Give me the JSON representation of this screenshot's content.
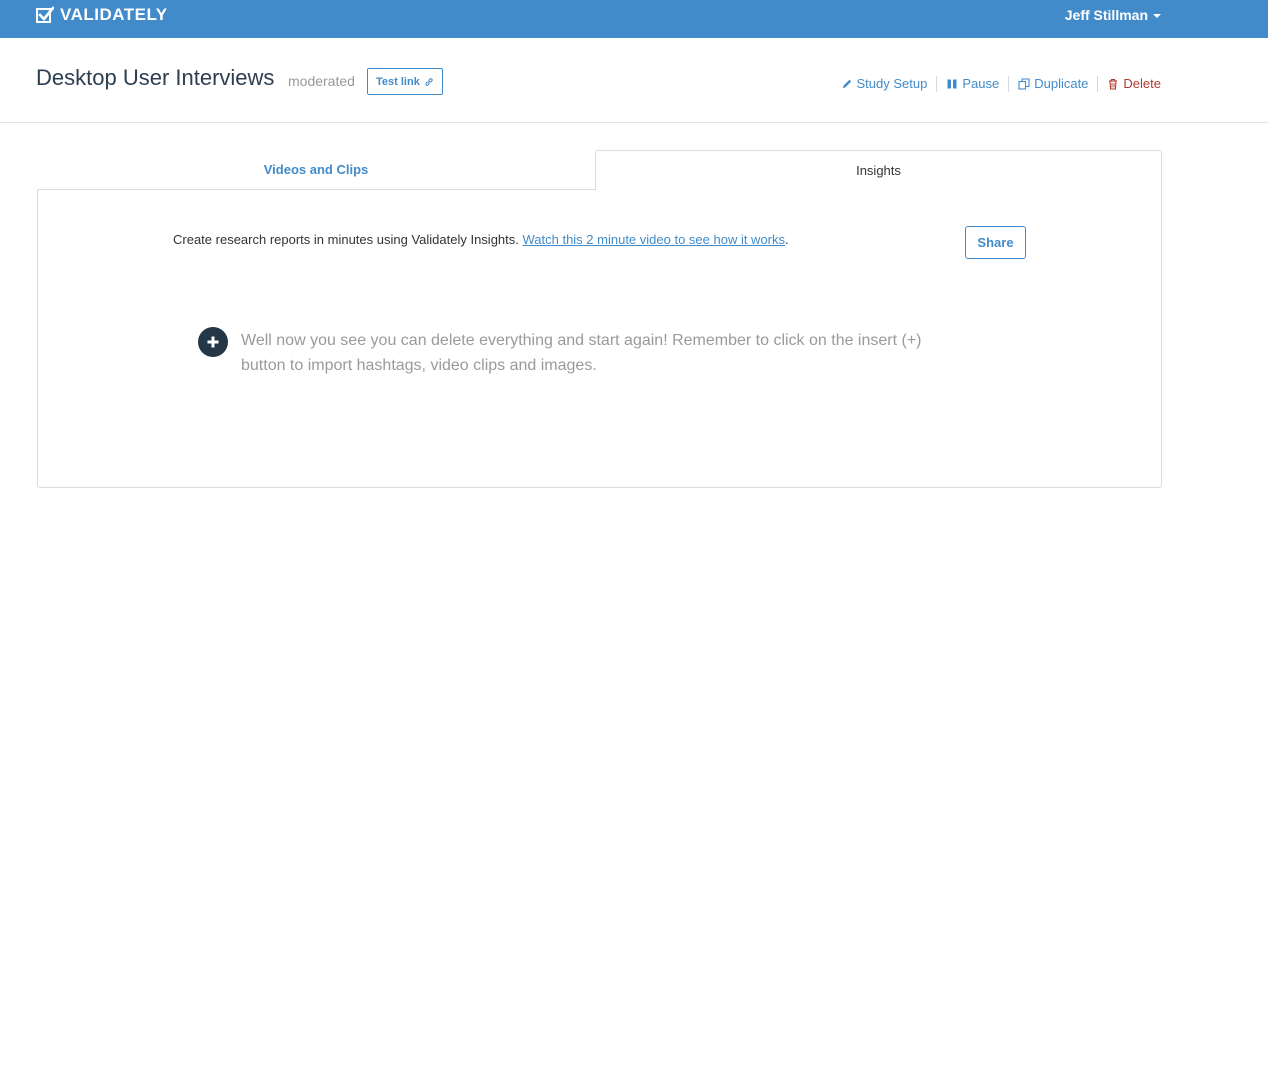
{
  "brand": {
    "name": "VALIDATELY",
    "nav_color": "#428bca"
  },
  "user": {
    "name": "Jeff Stillman"
  },
  "study": {
    "title": "Desktop User Interviews",
    "type": "moderated",
    "test_link_label": "Test link"
  },
  "actions": {
    "setup": "Study Setup",
    "pause": "Pause",
    "duplicate": "Duplicate",
    "delete": "Delete",
    "accent_color": "#428bca",
    "danger_color": "#b03a30"
  },
  "tabs": [
    {
      "label": "Videos and Clips",
      "active": false
    },
    {
      "label": "Insights",
      "active": true
    }
  ],
  "insights": {
    "intro_text": "Create research reports in minutes using Validately Insights. ",
    "intro_link": "Watch this 2 minute video to see how it works",
    "intro_end": ".",
    "share_label": "Share",
    "placeholder": "Well now you see you can delete everything and start again! Remember to click on the insert (+) button to import hashtags, video clips and images.",
    "insert_icon": "plus-icon"
  }
}
